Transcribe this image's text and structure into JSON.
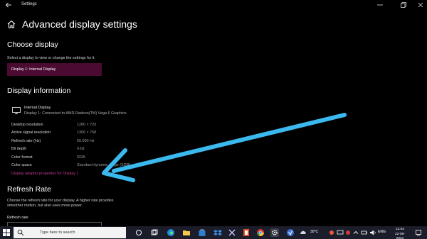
{
  "window": {
    "app_title": "Settings"
  },
  "page": {
    "title": "Advanced display settings"
  },
  "choose_display": {
    "heading": "Choose display",
    "description": "Select a display to view or change the settings for it.",
    "selected_display": "Display 1: Internal Display"
  },
  "display_information": {
    "heading": "Display information",
    "display_name": "Internal Display",
    "display_connection": "Display 1: Connected to AMD Radeon(TM) Vega 6 Graphics",
    "rows": [
      {
        "label": "Desktop resolution",
        "value": "1280 × 720"
      },
      {
        "label": "Active signal resolution",
        "value": "1366 × 768"
      },
      {
        "label": "Refresh rate (Hz)",
        "value": "60.000 Hz"
      },
      {
        "label": "Bit depth",
        "value": "6-bit"
      },
      {
        "label": "Color format",
        "value": "RGB"
      },
      {
        "label": "Color space",
        "value": "Standard dynamic range (SDR)"
      }
    ],
    "adapter_link": "Display adapter properties for Display 1"
  },
  "refresh_rate": {
    "heading": "Refresh Rate",
    "description_line1": "Choose the refresh rate for your display. A higher rate provides",
    "description_line2": "smoother motion, but also uses more power.",
    "field_label": "Refresh rate"
  },
  "taskbar": {
    "search_placeholder": "Type here to search",
    "weather": "30°C",
    "language": "ENG",
    "time": "11:04",
    "date": "22-09-2021"
  },
  "colors": {
    "accent_select": "#4a0a31",
    "link": "#c23a8f",
    "annotation_arrow": "#3bb9ee"
  }
}
